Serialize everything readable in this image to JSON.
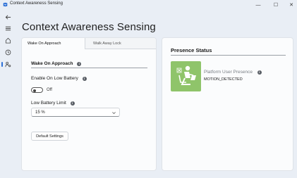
{
  "window": {
    "title": "Context Awareness Sensing",
    "controls": {
      "minimize": "—",
      "maximize": "☐",
      "close": "✕"
    }
  },
  "page": {
    "title": "Context Awareness Sensing"
  },
  "tabs": [
    {
      "label": "Wake On Approach",
      "active": true
    },
    {
      "label": "Walk Away Lock",
      "active": false
    }
  ],
  "wake_on_approach": {
    "section_title": "Wake On Approach",
    "enable_low_battery": {
      "label": "Enable On Low Battery",
      "state": "Off"
    },
    "low_battery_limit": {
      "label": "Low Battery Limit",
      "value": "15 %"
    },
    "default_button": "Default Settings"
  },
  "presence": {
    "title": "Presence Status",
    "item_name": "Platform User Presence",
    "item_status": "MOTION_DETECTED",
    "tile_color": "#8fc46a"
  },
  "info_glyph": "i"
}
